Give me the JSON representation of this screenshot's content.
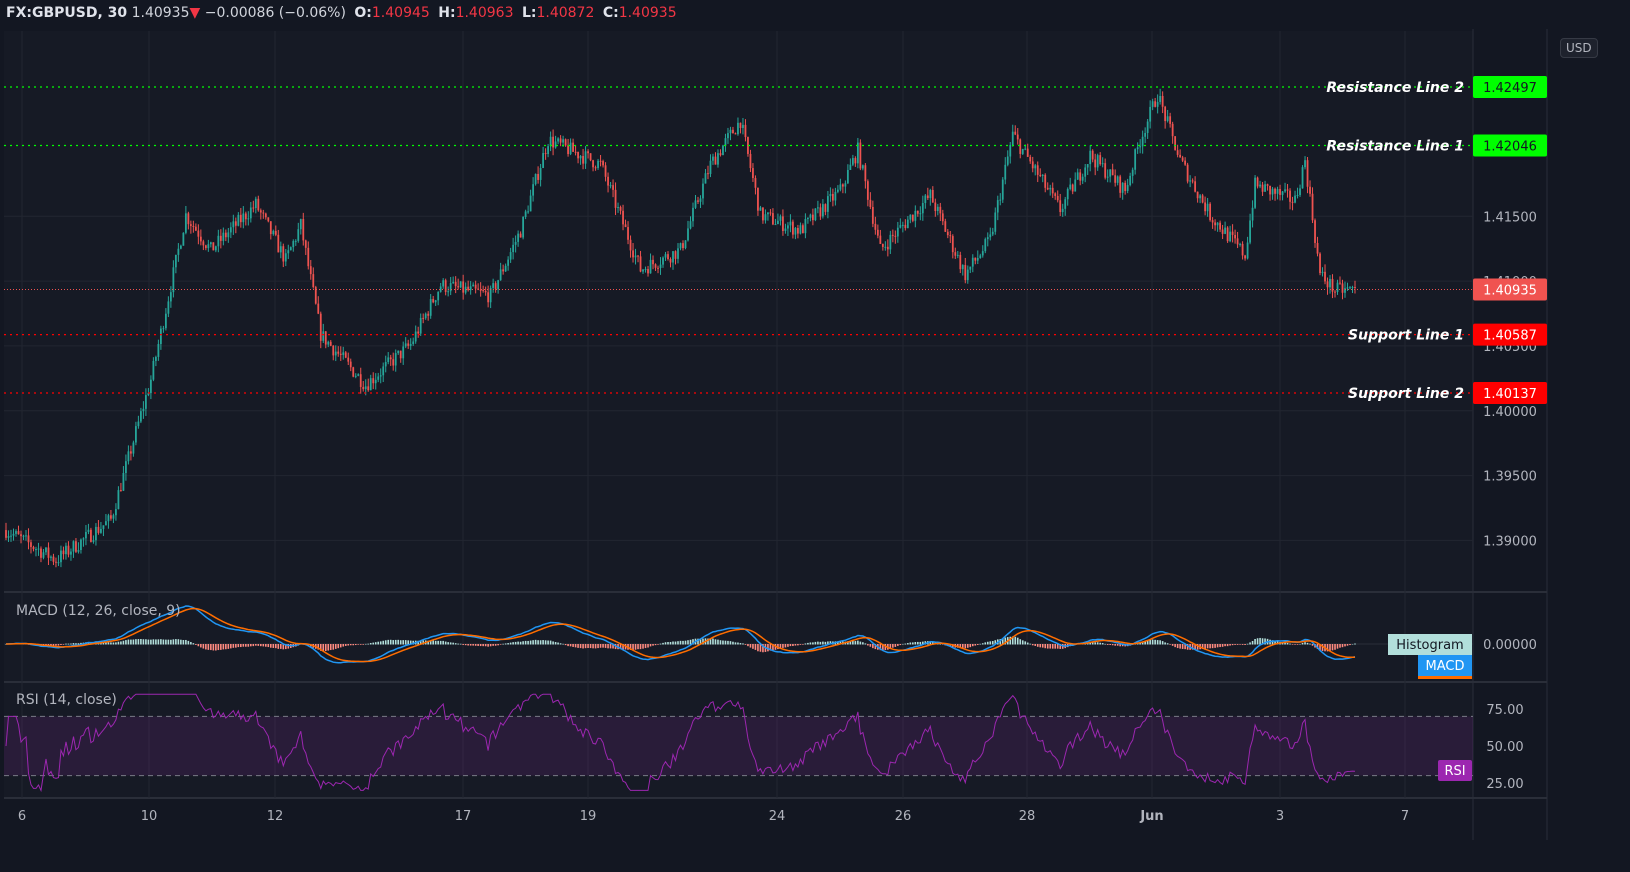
{
  "header": {
    "symbol": "FX:GBPUSD, 30",
    "last": "1.40935",
    "change_icon": "triangle-down-icon",
    "change": "−0.00086 (−0.06%)",
    "o_label": "O:",
    "o": "1.40945",
    "h_label": "H:",
    "h": "1.40963",
    "l_label": "L:",
    "l": "1.40872",
    "c_label": "C:",
    "c": "1.40935"
  },
  "currency": "USD",
  "price_axis": {
    "ticks": [
      "1.41500",
      "1.41000",
      "1.40500",
      "1.40000",
      "1.39500",
      "1.39000"
    ],
    "tick_values": [
      1.415,
      1.41,
      1.405,
      1.4,
      1.395,
      1.39
    ]
  },
  "lines": [
    {
      "label": "Resistance Line 2",
      "value": "1.42497",
      "color": "#00ff00"
    },
    {
      "label": "Resistance Line 1",
      "value": "1.42046",
      "color": "#00ff00"
    },
    {
      "label": "Support Line 1",
      "value": "1.40587",
      "color": "#ff0000"
    },
    {
      "label": "Support Line 2",
      "value": "1.40137",
      "color": "#ff0000"
    }
  ],
  "last_price_tag": {
    "value": "1.40935",
    "color": "#f05350"
  },
  "x_axis": {
    "ticks": [
      "6",
      "10",
      "12",
      "17",
      "19",
      "24",
      "26",
      "28",
      "Jun",
      "3",
      "7"
    ]
  },
  "macd": {
    "title": "MACD (12, 26, close, 9)",
    "zero_label": "0.00000",
    "histogram_tag": "Histogram",
    "macd_tag": "MACD",
    "macd_color": "#2196f3",
    "signal_color": "#ff6d00"
  },
  "rsi": {
    "title": "RSI (14, close)",
    "ticks": [
      "75.00",
      "50.00",
      "25.00"
    ],
    "tag": "RSI",
    "color": "#9c27b0",
    "bands": [
      70,
      30
    ]
  },
  "colors": {
    "up": "#26a69a",
    "down": "#ef5350",
    "background": "#131722"
  },
  "chart_data": {
    "type": "candlestick",
    "symbol": "FX:GBPUSD",
    "interval": "30",
    "ylim": [
      1.3855,
      1.429
    ],
    "price_path": [
      [
        0,
        1.3908
      ],
      [
        20,
        1.3885
      ],
      [
        42,
        1.3916
      ],
      [
        58,
        1.4024
      ],
      [
        72,
        1.4151
      ],
      [
        82,
        1.4124
      ],
      [
        100,
        1.4159
      ],
      [
        112,
        1.4116
      ],
      [
        118,
        1.4143
      ],
      [
        126,
        1.4059
      ],
      [
        144,
        1.402
      ],
      [
        162,
        1.4051
      ],
      [
        174,
        1.4097
      ],
      [
        194,
        1.4089
      ],
      [
        206,
        1.4139
      ],
      [
        217,
        1.4209
      ],
      [
        238,
        1.419
      ],
      [
        254,
        1.4109
      ],
      [
        270,
        1.4124
      ],
      [
        282,
        1.419
      ],
      [
        294,
        1.4224
      ],
      [
        302,
        1.4151
      ],
      [
        318,
        1.4139
      ],
      [
        334,
        1.417
      ],
      [
        341,
        1.4201
      ],
      [
        350,
        1.4124
      ],
      [
        370,
        1.4166
      ],
      [
        384,
        1.4105
      ],
      [
        394,
        1.4132
      ],
      [
        403,
        1.4213
      ],
      [
        422,
        1.4155
      ],
      [
        434,
        1.4197
      ],
      [
        448,
        1.417
      ],
      [
        454,
        1.4209
      ],
      [
        461,
        1.4244
      ],
      [
        470,
        1.4193
      ],
      [
        482,
        1.4151
      ],
      [
        496,
        1.412
      ],
      [
        500,
        1.4174
      ],
      [
        516,
        1.4162
      ],
      [
        520,
        1.4193
      ],
      [
        526,
        1.4105
      ],
      [
        532,
        1.4093
      ],
      [
        540,
        1.40935
      ]
    ]
  }
}
